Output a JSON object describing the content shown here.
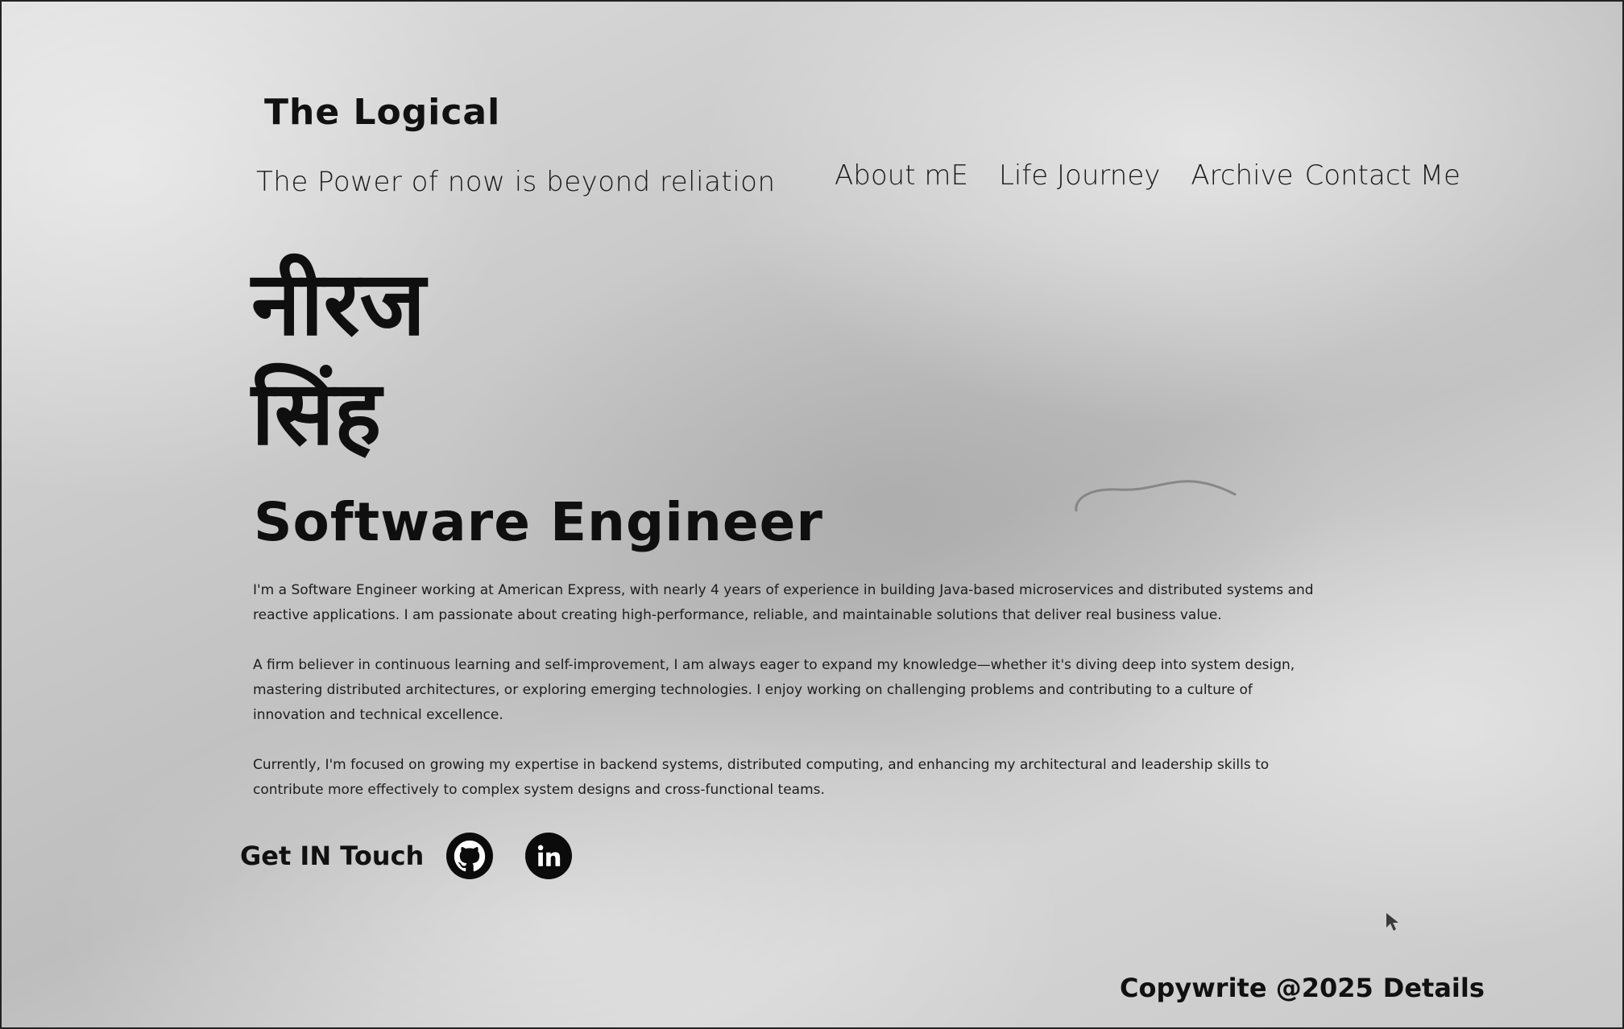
{
  "header": {
    "brand": "The Logical",
    "tagline": "The Power of now is beyond reliation"
  },
  "nav": {
    "items": [
      {
        "label": "About mE"
      },
      {
        "label": "Life Journey"
      },
      {
        "label": "Archive"
      },
      {
        "label": "Contact Me"
      }
    ]
  },
  "hero": {
    "name_line_1": "नीरज",
    "name_line_2": "सिंह",
    "role": "Software Engineer"
  },
  "bio": {
    "paragraphs": [
      "I'm a Software Engineer working at American Express, with nearly 4 years of experience in building Java-based microservices and distributed systems and reactive applications. I am passionate about creating high-performance, reliable, and maintainable solutions that deliver real business value.",
      "A firm believer in continuous learning and self-improvement, I am always eager to expand my knowledge—whether it's diving deep into system design, mastering distributed architectures, or exploring emerging technologies. I enjoy working on challenging problems and contributing to a culture of innovation and technical excellence.",
      "Currently, I'm focused on growing my expertise in backend systems, distributed computing, and enhancing my architectural and leadership skills to contribute more effectively to complex system designs and cross-functional teams."
    ]
  },
  "contact": {
    "label": "Get IN Touch",
    "icons": [
      "github-icon",
      "linkedin-icon"
    ]
  },
  "footer": {
    "copyright": "Copywrite @2025",
    "details": "Details"
  },
  "colors": {
    "background": "#cfcfcf",
    "text": "#111111",
    "icon_bg": "#0b0b0b"
  }
}
